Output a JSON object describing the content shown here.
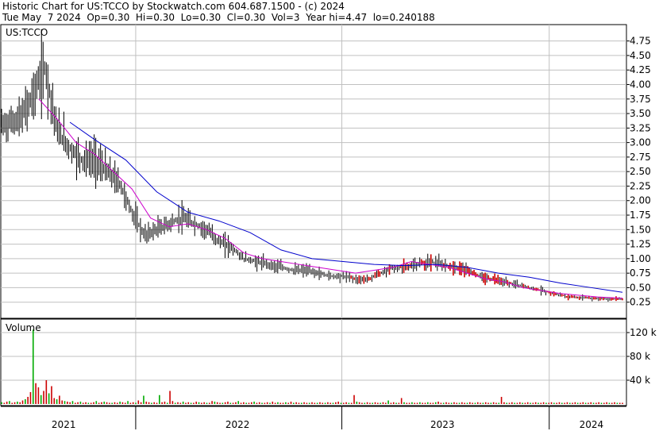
{
  "header": {
    "line1": "Historic Chart for US:TCCO by Stockwatch.com 604.687.1500 - (c) 2024",
    "line2": "Tue May  7 2024  Op=0.30  Hi=0.30  Lo=0.30  Cl=0.30  Vol=3  Year hi=4.47  lo=0.240188"
  },
  "chart_data": [
    {
      "type": "line",
      "title": "US:TCCO",
      "y_ticks": [
        "0.25",
        "0.50",
        "0.75",
        "1.00",
        "1.25",
        "1.50",
        "1.75",
        "2.00",
        "2.25",
        "2.50",
        "2.75",
        "3.00",
        "3.25",
        "3.50",
        "3.75",
        "4.00",
        "4.25",
        "4.50",
        "4.75"
      ],
      "ylim": [
        0.0,
        4.95
      ],
      "x_labels": [
        "2021",
        "2022",
        "2023",
        "2024"
      ],
      "grid": true,
      "series": [
        {
          "role": "price",
          "color": "#000000",
          "x": [
            0.0,
            0.03,
            0.05,
            0.07,
            0.09,
            0.11,
            0.13,
            0.15,
            0.17,
            0.19,
            0.21,
            0.23,
            0.25,
            0.27,
            0.29,
            0.31,
            0.33,
            0.35,
            0.37,
            0.39,
            0.41,
            0.43,
            0.45,
            0.47,
            0.49,
            0.51,
            0.53,
            0.55,
            0.57,
            0.59,
            0.61,
            0.63,
            0.65,
            0.67,
            0.69,
            0.71,
            0.73,
            0.75,
            0.77,
            0.79,
            0.81,
            0.83,
            0.85,
            0.87,
            0.89,
            0.91,
            0.93,
            0.95,
            0.97,
            1.0
          ],
          "y": [
            3.3,
            3.4,
            3.8,
            4.3,
            3.2,
            2.9,
            2.7,
            2.7,
            2.5,
            2.3,
            1.8,
            1.4,
            1.5,
            1.6,
            1.7,
            1.6,
            1.5,
            1.3,
            1.2,
            1.0,
            0.95,
            0.9,
            0.85,
            0.8,
            0.8,
            0.75,
            0.7,
            0.7,
            0.65,
            0.65,
            0.75,
            0.85,
            0.85,
            0.9,
            0.95,
            0.9,
            0.85,
            0.8,
            0.7,
            0.65,
            0.6,
            0.55,
            0.5,
            0.45,
            0.4,
            0.35,
            0.33,
            0.32,
            0.31,
            0.3
          ]
        },
        {
          "role": "ma-short",
          "color": "#cc00cc",
          "x": [
            0.06,
            0.09,
            0.12,
            0.15,
            0.18,
            0.21,
            0.24,
            0.27,
            0.3,
            0.33,
            0.36,
            0.39,
            0.42,
            0.45,
            0.48,
            0.51,
            0.54,
            0.57,
            0.6,
            0.63,
            0.66,
            0.69,
            0.72,
            0.75,
            0.78,
            0.81,
            0.84,
            0.87,
            0.9,
            0.93,
            0.96,
            1.0
          ],
          "y": [
            3.75,
            3.4,
            3.0,
            2.8,
            2.5,
            2.2,
            1.7,
            1.55,
            1.6,
            1.5,
            1.35,
            1.1,
            1.0,
            0.95,
            0.9,
            0.85,
            0.8,
            0.75,
            0.8,
            0.85,
            0.95,
            0.9,
            0.85,
            0.75,
            0.65,
            0.6,
            0.5,
            0.45,
            0.4,
            0.37,
            0.34,
            0.32
          ]
        },
        {
          "role": "ma-long",
          "color": "#0000cc",
          "x": [
            0.11,
            0.15,
            0.2,
            0.25,
            0.3,
            0.35,
            0.4,
            0.45,
            0.5,
            0.55,
            0.6,
            0.65,
            0.7,
            0.75,
            0.8,
            0.85,
            0.9,
            0.95,
            1.0
          ],
          "y": [
            3.35,
            3.05,
            2.7,
            2.15,
            1.8,
            1.65,
            1.45,
            1.15,
            1.0,
            0.95,
            0.9,
            0.88,
            0.9,
            0.85,
            0.75,
            0.68,
            0.58,
            0.5,
            0.42
          ]
        }
      ]
    },
    {
      "type": "bar",
      "title": "Volume",
      "y_ticks": [
        "40 k",
        "80 k",
        "120 k"
      ],
      "ylim": [
        0,
        140
      ],
      "grid": true,
      "values": [
        3,
        2,
        4,
        5,
        2,
        3,
        4,
        3,
        6,
        8,
        12,
        20,
        125,
        35,
        28,
        15,
        22,
        40,
        18,
        30,
        10,
        8,
        14,
        6,
        5,
        4,
        3,
        5,
        2,
        3,
        4,
        2,
        3,
        2,
        2,
        3,
        5,
        2,
        3,
        4,
        3,
        2,
        2,
        3,
        2,
        4,
        3,
        2,
        5,
        2,
        3,
        2,
        6,
        3,
        14,
        4,
        3,
        2,
        3,
        2,
        15,
        3,
        4,
        2,
        22,
        5,
        2,
        3,
        2,
        4,
        2,
        3,
        2,
        2,
        4,
        3,
        2,
        3,
        2,
        2,
        5,
        4,
        3,
        2,
        2,
        3,
        4,
        2,
        2,
        3,
        5,
        2,
        3,
        2,
        2,
        3,
        4,
        2,
        3,
        2,
        2,
        3,
        2,
        4,
        2,
        3,
        2,
        2,
        3,
        2,
        4,
        2,
        3,
        2,
        2,
        3,
        2,
        2,
        3,
        2,
        2,
        3,
        2,
        2,
        3,
        2,
        2,
        3,
        4,
        2,
        2,
        3,
        2,
        2,
        15,
        4,
        3,
        2,
        2,
        3,
        2,
        2,
        3,
        2,
        2,
        3,
        2,
        6,
        2,
        3,
        2,
        2,
        10,
        3,
        2,
        2,
        3,
        2,
        2,
        3,
        2,
        2,
        3,
        2,
        2,
        3,
        4,
        2,
        2,
        3,
        2,
        2,
        3,
        2,
        2,
        3,
        2,
        2,
        3,
        2,
        2,
        3,
        2,
        2,
        3,
        2,
        2,
        3,
        2,
        2,
        12,
        3,
        2,
        2,
        3,
        2,
        2,
        3,
        2,
        2,
        3,
        2,
        2,
        3,
        2,
        2,
        3,
        2,
        2,
        3,
        2,
        2,
        3,
        2,
        2,
        3,
        2,
        2,
        3,
        2,
        2,
        3,
        2,
        2,
        3,
        2,
        2,
        3,
        2,
        2,
        3,
        2,
        2,
        3,
        2,
        2,
        2
      ]
    }
  ],
  "colors": {
    "grid": "#c0c0c0",
    "frame": "#000000",
    "volume_up": "#00aa00",
    "volume_down": "#cc0000",
    "flat_tick": "#cc0000"
  }
}
